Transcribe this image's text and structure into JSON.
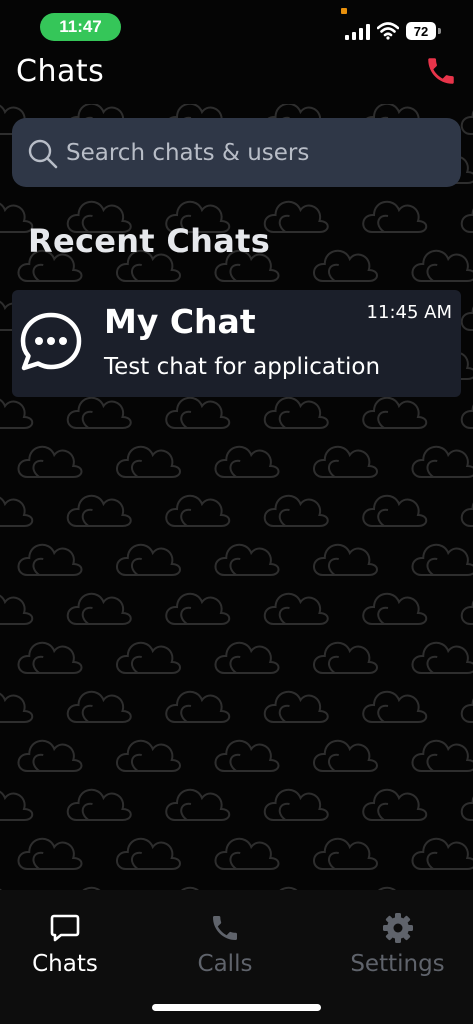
{
  "status_bar": {
    "time": "11:47",
    "battery": "72",
    "icons": [
      "signal-icon",
      "wifi-icon",
      "battery-icon"
    ]
  },
  "header": {
    "title": "Chats",
    "call_icon": "phone-icon",
    "call_color": "#e8344a"
  },
  "search": {
    "placeholder": "Search chats & users",
    "value": "",
    "icon": "search-icon"
  },
  "recent": {
    "title": "Recent Chats",
    "chats": [
      {
        "name": "My Chat",
        "time": "11:45 AM",
        "preview": "Test chat for application",
        "icon": "chat-bubble-icon"
      }
    ]
  },
  "tabs": [
    {
      "label": "Chats",
      "icon": "chat-icon",
      "active": true
    },
    {
      "label": "Calls",
      "icon": "phone-icon",
      "active": false
    },
    {
      "label": "Settings",
      "icon": "gear-icon",
      "active": false
    }
  ],
  "colors": {
    "background": "#050505",
    "search_bg": "#2f3747",
    "card_bg": "#1b1f2a",
    "time_pill": "#35c659",
    "inactive_tab": "#5f636b"
  }
}
